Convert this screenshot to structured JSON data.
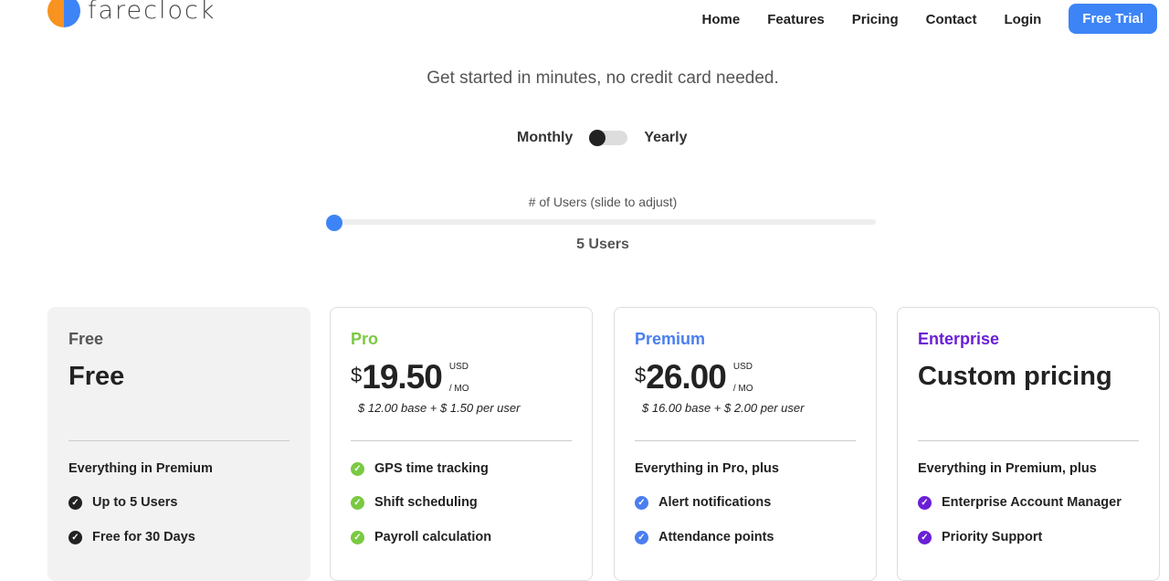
{
  "brand": {
    "name": "fareclock"
  },
  "nav": {
    "items": [
      "Home",
      "Features",
      "Pricing",
      "Contact",
      "Login"
    ],
    "cta": "Free Trial"
  },
  "subtitle": "Get started in minutes, no credit card needed.",
  "billing": {
    "monthly": "Monthly",
    "yearly": "Yearly",
    "selected": "Monthly"
  },
  "users_slider": {
    "label": "# of Users (slide to adjust)",
    "value_text": "5 Users",
    "value": 5
  },
  "colors": {
    "accent": "#3d84f7",
    "pro": "#7ac943",
    "premium": "#4a7ef0",
    "enterprise": "#6a1fd6",
    "free": "#555555"
  },
  "plans": [
    {
      "tier": "Free",
      "headline": "Free",
      "lead": "Everything in Premium",
      "features": [
        "Up to 5 Users",
        "Free for 30 Days"
      ]
    },
    {
      "tier": "Pro",
      "currency": "$",
      "amount": "19.50",
      "usd": "USD",
      "per": "/ MO",
      "formula": "$ 12.00 base + $ 1.50 per user",
      "features": [
        "GPS time tracking",
        "Shift scheduling",
        "Payroll calculation"
      ]
    },
    {
      "tier": "Premium",
      "currency": "$",
      "amount": "26.00",
      "usd": "USD",
      "per": "/ MO",
      "formula": "$ 16.00 base + $ 2.00 per user",
      "lead": "Everything in Pro, plus",
      "features": [
        "Alert notifications",
        "Attendance points"
      ]
    },
    {
      "tier": "Enterprise",
      "headline": "Custom pricing",
      "lead": "Everything in Premium, plus",
      "features": [
        "Enterprise Account Manager",
        "Priority Support"
      ]
    }
  ]
}
